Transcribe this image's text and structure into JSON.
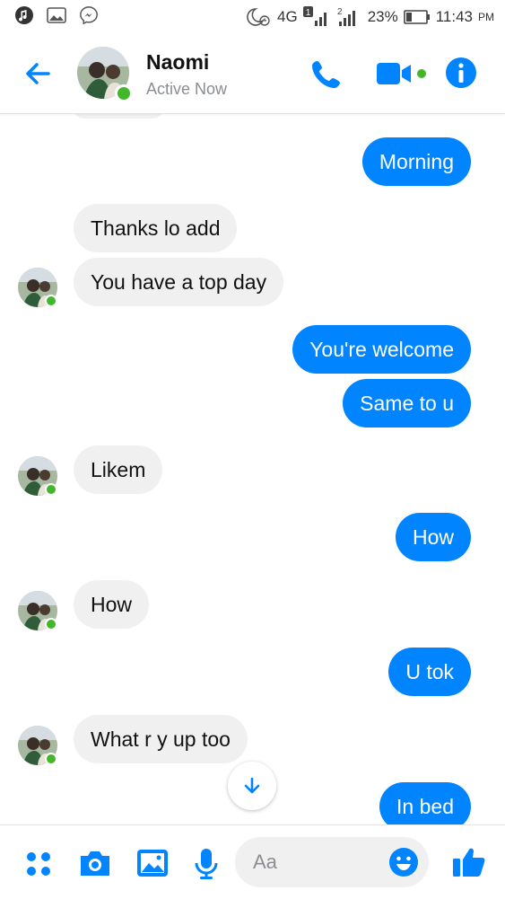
{
  "status_bar": {
    "network": "4G",
    "sim1": "1",
    "sim2": "2",
    "battery": "23%",
    "time": "11:43",
    "ampm": "PM"
  },
  "header": {
    "contact_name": "Naomi",
    "presence": "Active Now"
  },
  "messages": [
    {
      "dir": "out",
      "text": "Morning"
    },
    {
      "dir": "in",
      "text": "Thanks lo add"
    },
    {
      "dir": "in",
      "text": "You have a top day"
    },
    {
      "dir": "out",
      "text": "You're welcome"
    },
    {
      "dir": "out",
      "text": "Same to u"
    },
    {
      "dir": "in",
      "text": "Likem"
    },
    {
      "dir": "out",
      "text": "How"
    },
    {
      "dir": "in",
      "text": "How"
    },
    {
      "dir": "out",
      "text": "U tok"
    },
    {
      "dir": "in",
      "text": "What r y up too"
    },
    {
      "dir": "out",
      "text": "In bed"
    }
  ],
  "composer": {
    "placeholder": "Aa"
  },
  "colors": {
    "accent": "#0084ff",
    "incoming_bubble": "#f1f0f0",
    "online": "#42b72a"
  }
}
